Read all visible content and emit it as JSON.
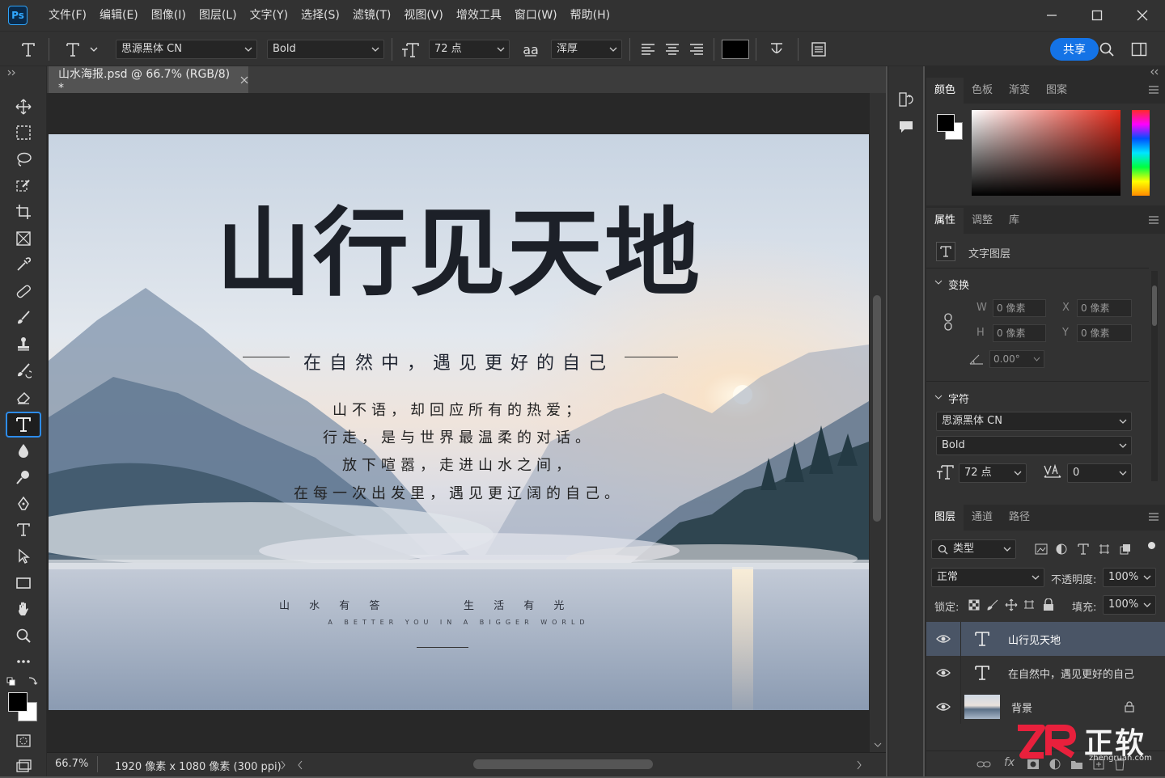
{
  "app": {
    "logo": "Ps"
  },
  "menu": [
    "文件(F)",
    "编辑(E)",
    "图像(I)",
    "图层(L)",
    "文字(Y)",
    "选择(S)",
    "滤镜(T)",
    "视图(V)",
    "增效工具",
    "窗口(W)",
    "帮助(H)"
  ],
  "options": {
    "font_family": "思源黑体 CN",
    "font_style": "Bold",
    "font_size": "72 点",
    "aa_icon": "a͟a",
    "antialias": "浑厚",
    "share": "共享"
  },
  "document": {
    "tab_title": "山水海报.psd @ 66.7% (RGB/8) *"
  },
  "artwork": {
    "title": "山行见天地",
    "subtitle": "在自然中，遇见更好的自己",
    "poem": [
      "山不语，却回应所有的热爱；",
      "行走，是与世界最温柔的对话。",
      "放下喧嚣，走进山水之间，",
      "在每一次出发里，遇见更辽阔的自己。"
    ],
    "tagline_left": "山 水 有 答",
    "tagline_right": "生 活 有 光",
    "english": "A BETTER YOU IN A BIGGER WORLD"
  },
  "status": {
    "zoom": "66.7%",
    "size": "1920 像素 x 1080 像素 (300 ppi)"
  },
  "color_panel": {
    "tabs": [
      "颜色",
      "色板",
      "渐变",
      "图案"
    ]
  },
  "properties_panel": {
    "tabs": [
      "属性",
      "调整",
      "库"
    ],
    "layer_kind": "文字图层",
    "transform_label": "变换",
    "w_label": "W",
    "w_value": "0 像素",
    "x_label": "X",
    "x_value": "0 像素",
    "h_label": "H",
    "h_value": "0 像素",
    "y_label": "Y",
    "y_value": "0 像素",
    "angle": "0.00°",
    "character_label": "字符",
    "font_family": "思源黑体 CN",
    "font_style": "Bold",
    "font_size": "72 点",
    "tracking": "0"
  },
  "layers_panel": {
    "tabs": [
      "图层",
      "通道",
      "路径"
    ],
    "filter": "类型",
    "blend_mode": "正常",
    "opacity_label": "不透明度:",
    "opacity": "100%",
    "lock_label": "锁定:",
    "fill_label": "填充:",
    "fill": "100%",
    "layers": [
      {
        "name": "山行见天地",
        "type": "text"
      },
      {
        "name": "在自然中，遇见更好的自己",
        "type": "text"
      },
      {
        "name": "背景",
        "type": "image"
      }
    ]
  },
  "watermark": {
    "brand": "正软",
    "url": "zhengruan.com"
  },
  "colors": {
    "accent": "#1473e6",
    "foreground": "#000000",
    "background": "#ffffff"
  }
}
